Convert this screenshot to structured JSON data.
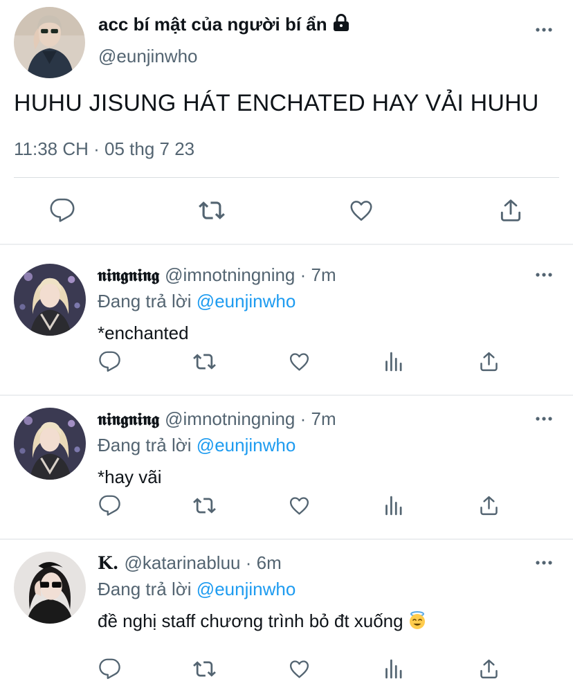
{
  "main_tweet": {
    "display_name": "acc bí mật của người bí ẩn",
    "handle": "@eunjinwho",
    "text": "HUHU JISUNG HÁT ENCHATED HAY VẢI HUHU",
    "timestamp": "11:38 CH · 05 thg 7 23",
    "icons": [
      "lock-icon",
      "more-icon",
      "reply-icon",
      "retweet-icon",
      "like-icon",
      "share-icon"
    ]
  },
  "replies": [
    {
      "display_name": "𝖓𝖎𝖓𝖌𝖓𝖎𝖓𝖌",
      "handle": "@imnotningning",
      "separator": "·",
      "time": "7m",
      "replying_prefix": "Đang trả lời",
      "replying_to": "@eunjinwho",
      "text": "*enchanted"
    },
    {
      "display_name": "𝖓𝖎𝖓𝖌𝖓𝖎𝖓𝖌",
      "handle": "@imnotningning",
      "separator": "·",
      "time": "7m",
      "replying_prefix": "Đang trả lời",
      "replying_to": "@eunjinwho",
      "text": "*hay vãi"
    },
    {
      "display_name": "𝐊.",
      "handle": "@katarinabluu",
      "separator": "·",
      "time": "6m",
      "replying_prefix": "Đang trả lời",
      "replying_to": "@eunjinwho",
      "text": "đề nghị staff chương trình bỏ đt xuống"
    }
  ],
  "colors": {
    "text": "#0f1419",
    "secondary": "#536471",
    "link": "#1d9bf0",
    "divider": "#eceef0"
  }
}
